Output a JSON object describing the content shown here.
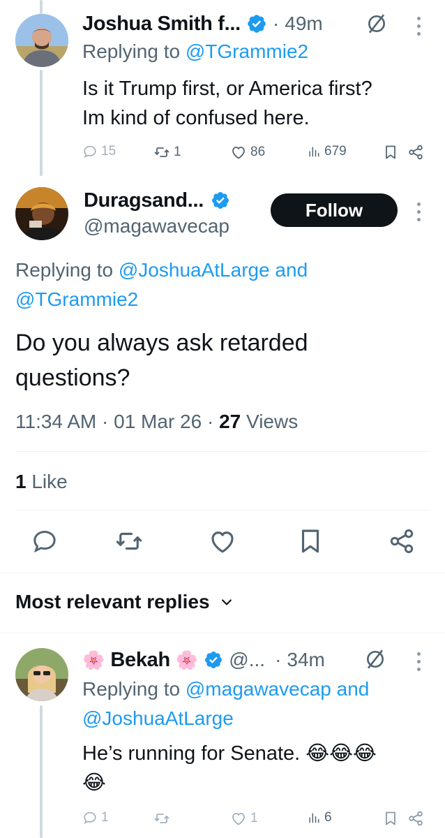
{
  "tweet1": {
    "name": "Joshua Smith f...",
    "time": "49m",
    "replying_prefix": "Replying to ",
    "replying_handle": "@TGrammie2",
    "text_line1": "Is it Trump first, or America first?",
    "text_line2": "Im kind of confused here.",
    "replies": "15",
    "reposts": "1",
    "likes": "86",
    "views": "679"
  },
  "main_tweet": {
    "name": "Duragsand...",
    "handle": "@magawavecap",
    "follow_label": "Follow",
    "replying_prefix": "Replying to ",
    "replying_handle1": "@JoshuaAtLarge",
    "replying_and": " and",
    "replying_handle2": "@TGrammie2",
    "text_line1": "Do you always ask retarded",
    "text_line2": "questions?",
    "time": "11:34 AM",
    "date": "01 Mar 26",
    "views_count": "27",
    "views_label": "Views",
    "likes_count": "1",
    "likes_label": "Like"
  },
  "replies_header": {
    "label": "Most relevant replies"
  },
  "tweet3": {
    "name": "Bekah",
    "handle": "@...",
    "time": "34m",
    "replying_prefix": "Replying to ",
    "replying_handle1": "@magawavecap",
    "replying_and": " and",
    "replying_handle2": "@JoshuaAtLarge",
    "text_line1": "He’s running for Senate. 😂😂😂",
    "text_line2": "😂",
    "replies": "1",
    "likes": "1",
    "views": "6"
  },
  "icons": {
    "verified": "verified-badge-icon",
    "grok": "circle-slash-icon",
    "reply": "speech-bubble-icon",
    "repost": "repost-arrows-icon",
    "like": "heart-icon",
    "views": "bar-chart-icon",
    "bookmark": "bookmark-icon",
    "share": "share-icon",
    "more": "vertical-dots-icon",
    "chevron": "chevron-down-icon",
    "flower": "cherry-blossom-icon"
  },
  "colors": {
    "link": "#1d9bf0",
    "text": "#0f1419",
    "secondary": "#536471",
    "thread_line": "#cfd9de",
    "follow_bg": "#0f1419"
  }
}
